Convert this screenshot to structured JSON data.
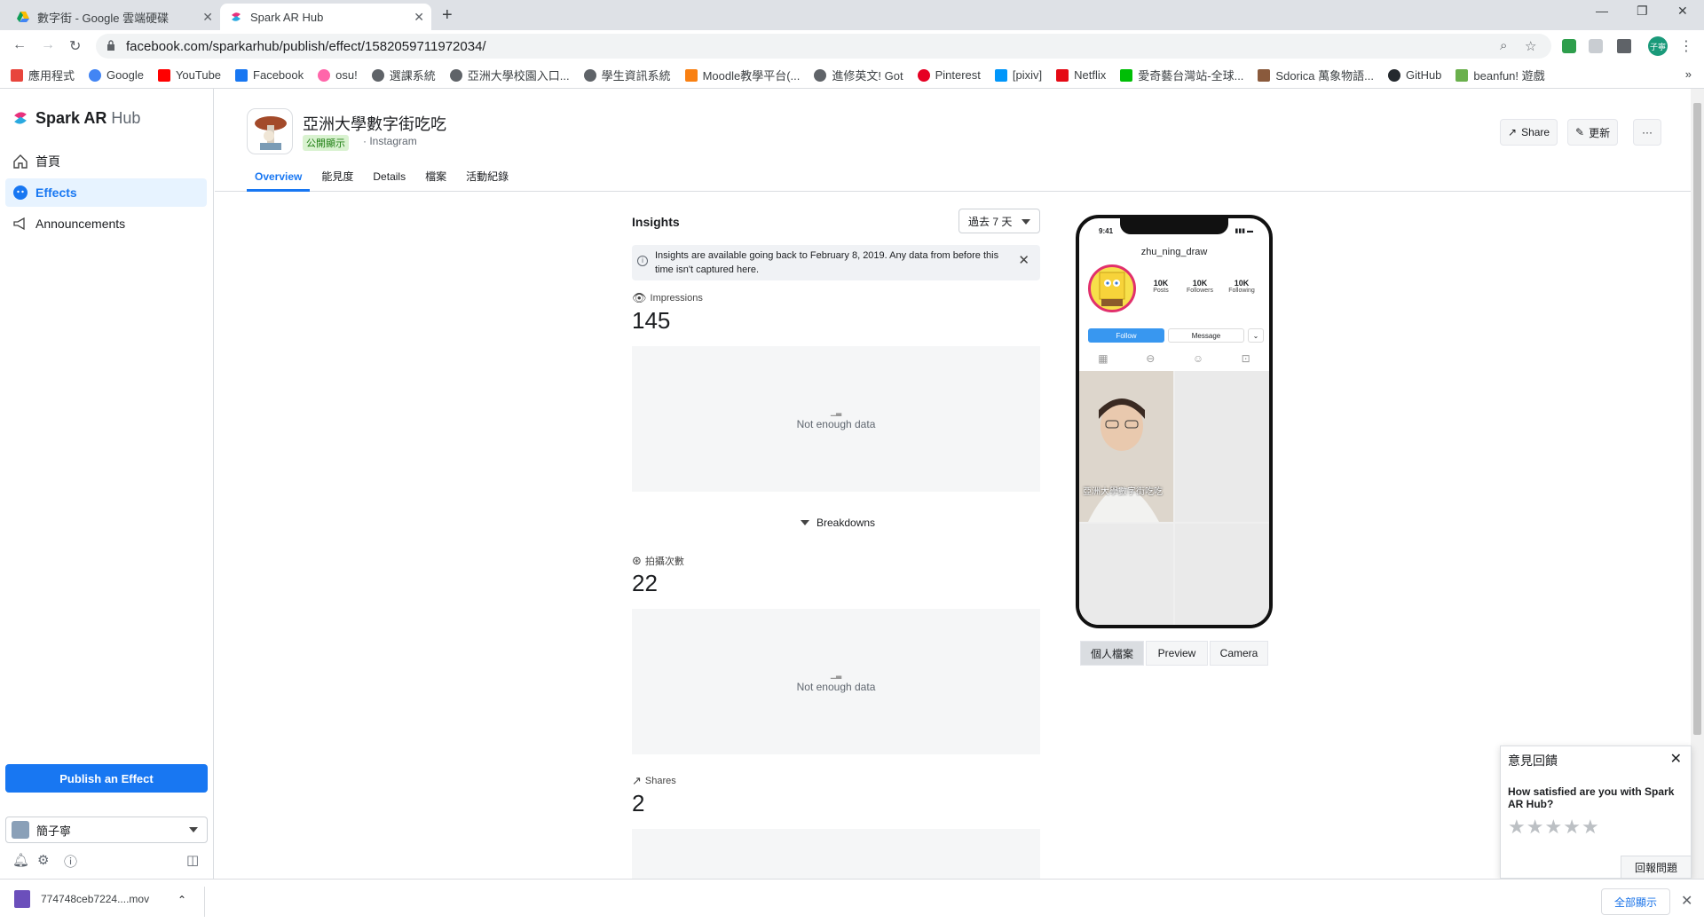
{
  "browser": {
    "tabs": [
      {
        "title": "數字街 - Google 雲端硬碟"
      },
      {
        "title": "Spark AR Hub"
      }
    ],
    "url": "facebook.com/sparkarhub/publish/effect/1582059711972034/",
    "profile_initials": "子寧",
    "bookmarks": [
      {
        "label": "應用程式",
        "color": "#e8453c"
      },
      {
        "label": "Google",
        "color": "#4285f4"
      },
      {
        "label": "YouTube",
        "color": "#ff0000"
      },
      {
        "label": "Facebook",
        "color": "#1877f2"
      },
      {
        "label": "osu!",
        "color": "#ff66aa"
      },
      {
        "label": "選課系統",
        "color": "#5f6368"
      },
      {
        "label": "亞洲大學校園入口...",
        "color": "#5f6368"
      },
      {
        "label": "學生資訊系統",
        "color": "#5f6368"
      },
      {
        "label": "Moodle教學平台(...",
        "color": "#f98012"
      },
      {
        "label": "進修英文! Got",
        "color": "#5f6368"
      },
      {
        "label": "Pinterest",
        "color": "#e60023"
      },
      {
        "label": "[pixiv]",
        "color": "#0096fa"
      },
      {
        "label": "Netflix",
        "color": "#e50914"
      },
      {
        "label": "愛奇藝台灣站-全球...",
        "color": "#00be06"
      },
      {
        "label": "Sdorica 萬象物語...",
        "color": "#8a5a3c"
      },
      {
        "label": "GitHub",
        "color": "#24292e"
      },
      {
        "label": "beanfun! 遊戲",
        "color": "#6ab04c"
      }
    ]
  },
  "sidebar": {
    "brand": "Spark AR",
    "brand_suffix": "Hub",
    "items": [
      {
        "label": "首頁"
      },
      {
        "label": "Effects"
      },
      {
        "label": "Announcements"
      }
    ],
    "publish_label": "Publish an Effect",
    "user_name": "簡子寧"
  },
  "header": {
    "effect_title": "亞洲大學數字街吃吃",
    "status": "公開顯示",
    "platform": "Instagram",
    "share_label": "Share",
    "update_label": "更新",
    "more_label": "···",
    "tabs": [
      {
        "label": "Overview"
      },
      {
        "label": "能見度"
      },
      {
        "label": "Details"
      },
      {
        "label": "檔案"
      },
      {
        "label": "活動紀錄"
      }
    ]
  },
  "insights": {
    "title": "Insights",
    "range": "過去 7 天",
    "notice": "Insights are available going back to February 8, 2019. Any data from before this time isn't captured here.",
    "metrics": [
      {
        "label": "Impressions",
        "value": "145",
        "empty": "Not enough data"
      },
      {
        "label": "拍攝次數",
        "value": "22",
        "empty": "Not enough data"
      },
      {
        "label": "Shares",
        "value": "2"
      }
    ],
    "breakdowns_label": "Breakdowns"
  },
  "preview": {
    "time": "9:41",
    "username": "zhu_ning_draw",
    "stats": [
      {
        "num": "10K",
        "label": "Posts"
      },
      {
        "num": "10K",
        "label": "Followers"
      },
      {
        "num": "10K",
        "label": "Following"
      }
    ],
    "follow_label": "Follow",
    "message_label": "Message",
    "caption": "亞洲大學數字街吃吃",
    "modes": [
      {
        "label": "個人檔案"
      },
      {
        "label": "Preview"
      },
      {
        "label": "Camera"
      }
    ]
  },
  "feedback": {
    "title": "意見回饋",
    "question": "How satisfied are you with Spark AR Hub?",
    "report_label": "回報問題"
  },
  "downloads": {
    "file": "774748ceb7224....mov",
    "show_all": "全部顯示"
  }
}
